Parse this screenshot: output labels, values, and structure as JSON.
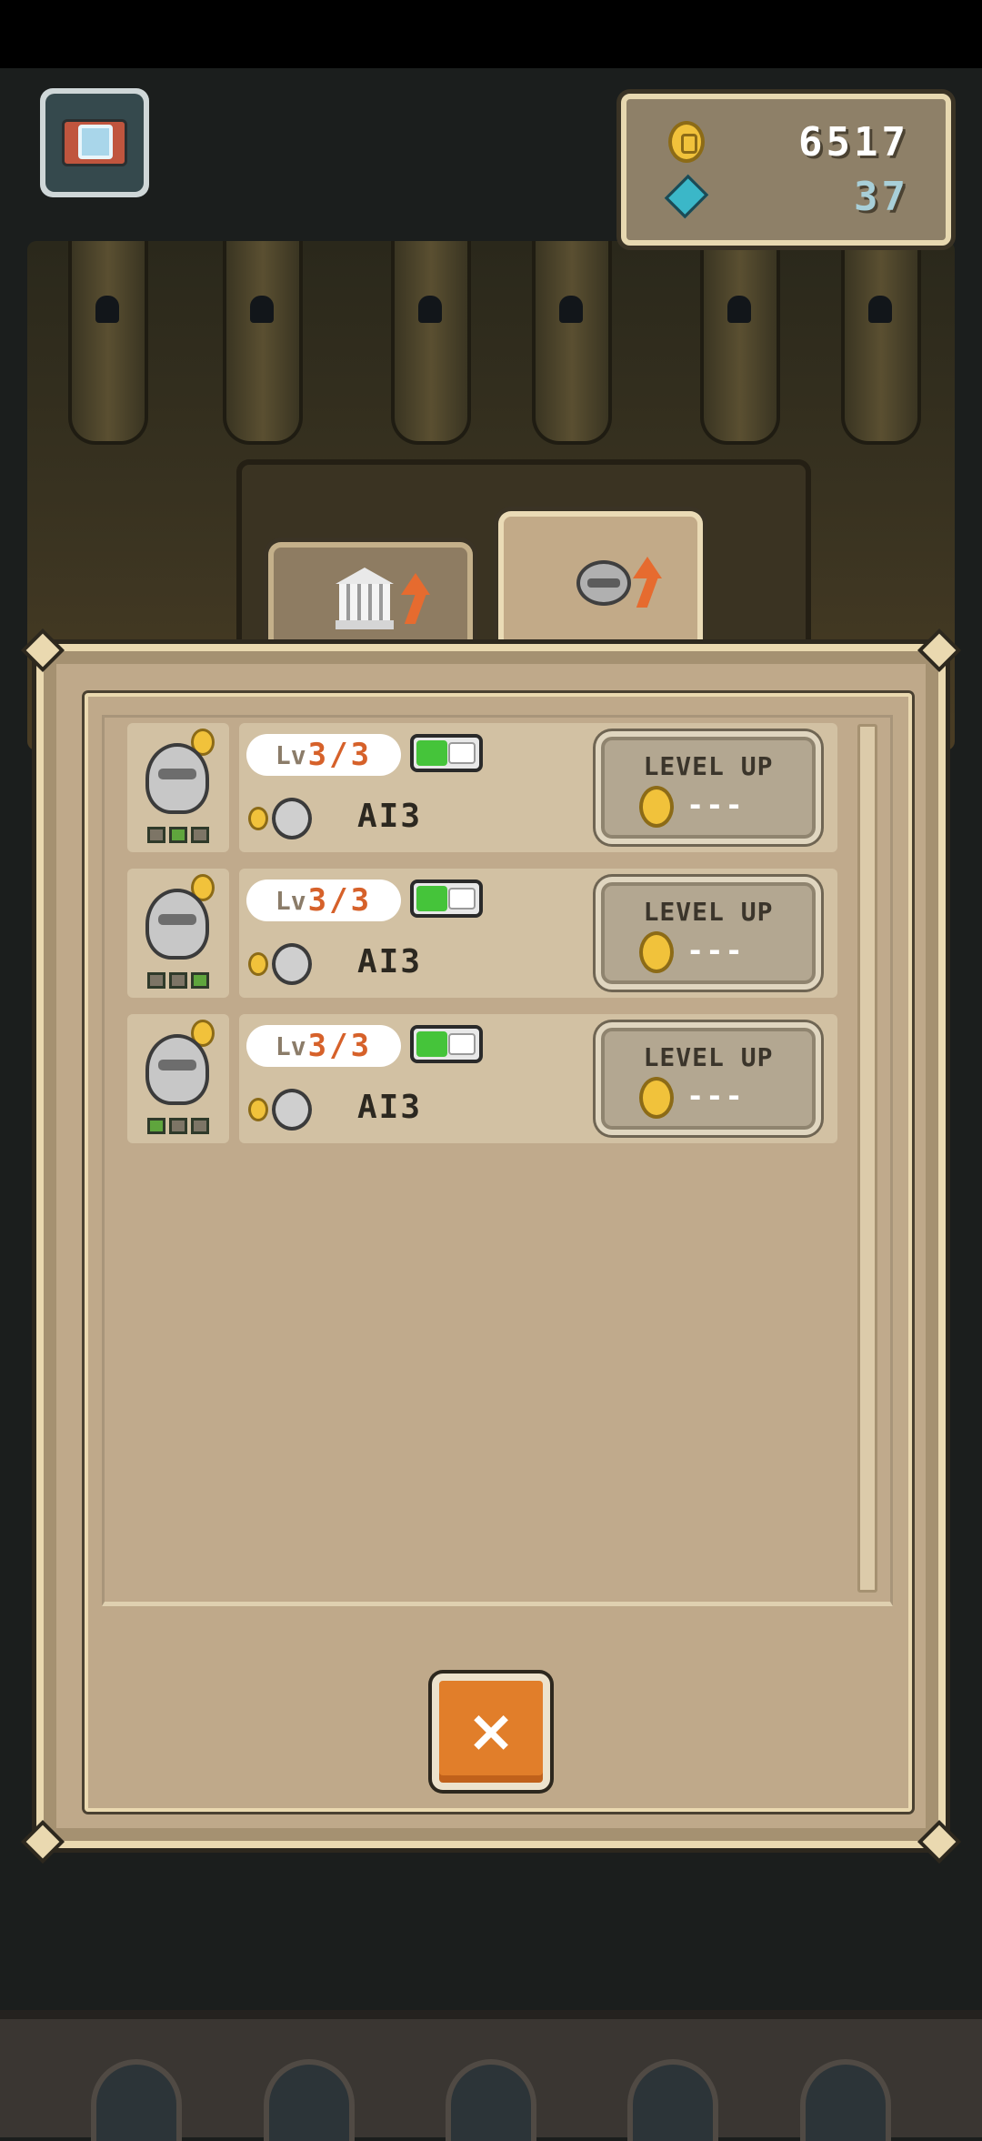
{
  "hud": {
    "gold": "6517",
    "gems": "37"
  },
  "tabs": [
    {
      "name": "building-upgrade",
      "icon": "building-icon"
    },
    {
      "name": "robot-upgrade",
      "icon": "robot-icon",
      "active": true
    }
  ],
  "robots": [
    {
      "level_prefix": "Lv",
      "level": "3/3",
      "enabled": true,
      "ai_label": "AI3",
      "leds": [
        false,
        true,
        false
      ],
      "button_label": "LEVEL UP",
      "cost": "---"
    },
    {
      "level_prefix": "Lv",
      "level": "3/3",
      "enabled": true,
      "ai_label": "AI3",
      "leds": [
        false,
        false,
        true
      ],
      "button_label": "LEVEL UP",
      "cost": "---"
    },
    {
      "level_prefix": "Lv",
      "level": "3/3",
      "enabled": true,
      "ai_label": "AI3",
      "leds": [
        true,
        false,
        false
      ],
      "button_label": "LEVEL UP",
      "cost": "---"
    }
  ],
  "close_symbol": "×",
  "colors": {
    "panel": "#bfa98a",
    "accent_orange": "#e17e2a",
    "level_text": "#d6612a",
    "toggle_on": "#45c43a"
  }
}
